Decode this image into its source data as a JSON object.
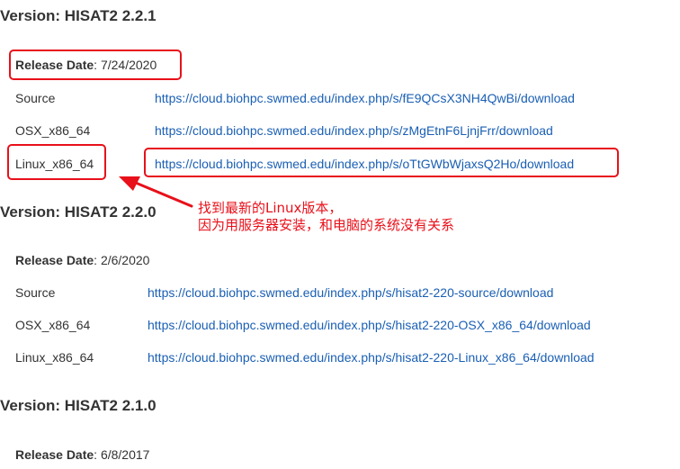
{
  "sections": [
    {
      "heading": "Version: HISAT2 2.2.1",
      "release_label": "Release Date",
      "release_date": ": 7/24/2020",
      "rows": [
        {
          "platform": "Source",
          "url": "https://cloud.biohpc.swmed.edu/index.php/s/fE9QCsX3NH4QwBi/download"
        },
        {
          "platform": "OSX_x86_64",
          "url": "https://cloud.biohpc.swmed.edu/index.php/s/zMgEtnF6LjnjFrr/download"
        },
        {
          "platform": "Linux_x86_64",
          "url": "https://cloud.biohpc.swmed.edu/index.php/s/oTtGWbWjaxsQ2Ho/download"
        }
      ]
    },
    {
      "heading": "Version: HISAT2 2.2.0",
      "release_label": "Release Date",
      "release_date": ": 2/6/2020",
      "rows": [
        {
          "platform": "Source",
          "url": "https://cloud.biohpc.swmed.edu/index.php/s/hisat2-220-source/download"
        },
        {
          "platform": "OSX_x86_64",
          "url": "https://cloud.biohpc.swmed.edu/index.php/s/hisat2-220-OSX_x86_64/download"
        },
        {
          "platform": "Linux_x86_64",
          "url": "https://cloud.biohpc.swmed.edu/index.php/s/hisat2-220-Linux_x86_64/download"
        }
      ]
    },
    {
      "heading": "Version: HISAT2 2.1.0",
      "release_label": "Release Date",
      "release_date": ": 6/8/2017"
    }
  ],
  "annotation": {
    "line1": "找到最新的Linux版本，",
    "line2": "因为用服务器安装，和电脑的系统没有关系",
    "color": "#e8101a"
  },
  "colors": {
    "link": "#1a5fb4",
    "text": "#333333",
    "highlight": "#e8101a"
  }
}
